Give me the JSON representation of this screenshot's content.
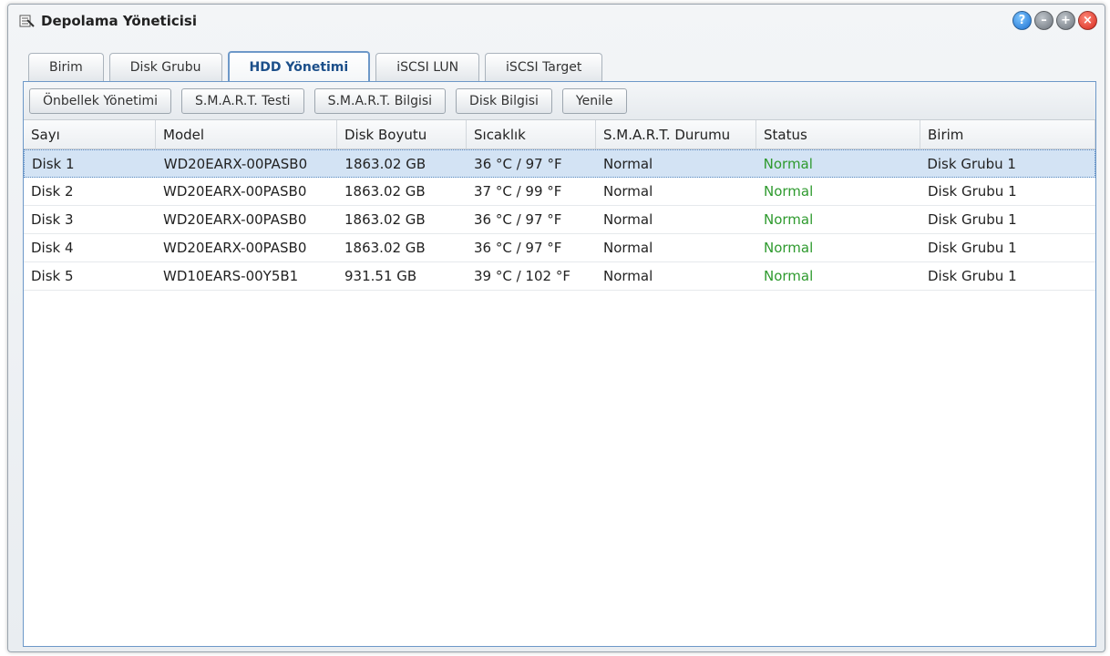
{
  "window": {
    "title": "Depolama Yöneticisi"
  },
  "tabs": [
    {
      "label": "Birim",
      "active": false
    },
    {
      "label": "Disk Grubu",
      "active": false
    },
    {
      "label": "HDD Yönetimi",
      "active": true
    },
    {
      "label": "iSCSI LUN",
      "active": false
    },
    {
      "label": "iSCSI Target",
      "active": false
    }
  ],
  "toolbar": {
    "cache": "Önbellek Yönetimi",
    "smart_test": "S.M.A.R.T. Testi",
    "smart_info": "S.M.A.R.T. Bilgisi",
    "disk_info": "Disk Bilgisi",
    "refresh": "Yenile"
  },
  "table": {
    "headers": [
      "Sayı",
      "Model",
      "Disk Boyutu",
      "Sıcaklık",
      "S.M.A.R.T. Durumu",
      "Status",
      "Birim"
    ],
    "rows": [
      [
        "Disk 1",
        "WD20EARX-00PASB0",
        "1863.02 GB",
        "36 °C / 97 °F",
        "Normal",
        "Normal",
        "Disk Grubu 1"
      ],
      [
        "Disk 2",
        "WD20EARX-00PASB0",
        "1863.02 GB",
        "37 °C / 99 °F",
        "Normal",
        "Normal",
        "Disk Grubu 1"
      ],
      [
        "Disk 3",
        "WD20EARX-00PASB0",
        "1863.02 GB",
        "36 °C / 97 °F",
        "Normal",
        "Normal",
        "Disk Grubu 1"
      ],
      [
        "Disk 4",
        "WD20EARX-00PASB0",
        "1863.02 GB",
        "36 °C / 97 °F",
        "Normal",
        "Normal",
        "Disk Grubu 1"
      ],
      [
        "Disk 5",
        "WD10EARS-00Y5B1",
        "931.51 GB",
        "39 °C / 102 °F",
        "Normal",
        "Normal",
        "Disk Grubu 1"
      ]
    ],
    "selected_row": 0
  },
  "colors": {
    "accent": "#1c4f8a",
    "status_ok": "#2e9a2e",
    "selection": "#d3e3f4"
  },
  "icons": [
    "storage-manager-icon",
    "help-icon",
    "minimize-icon",
    "maximize-icon",
    "close-icon"
  ]
}
